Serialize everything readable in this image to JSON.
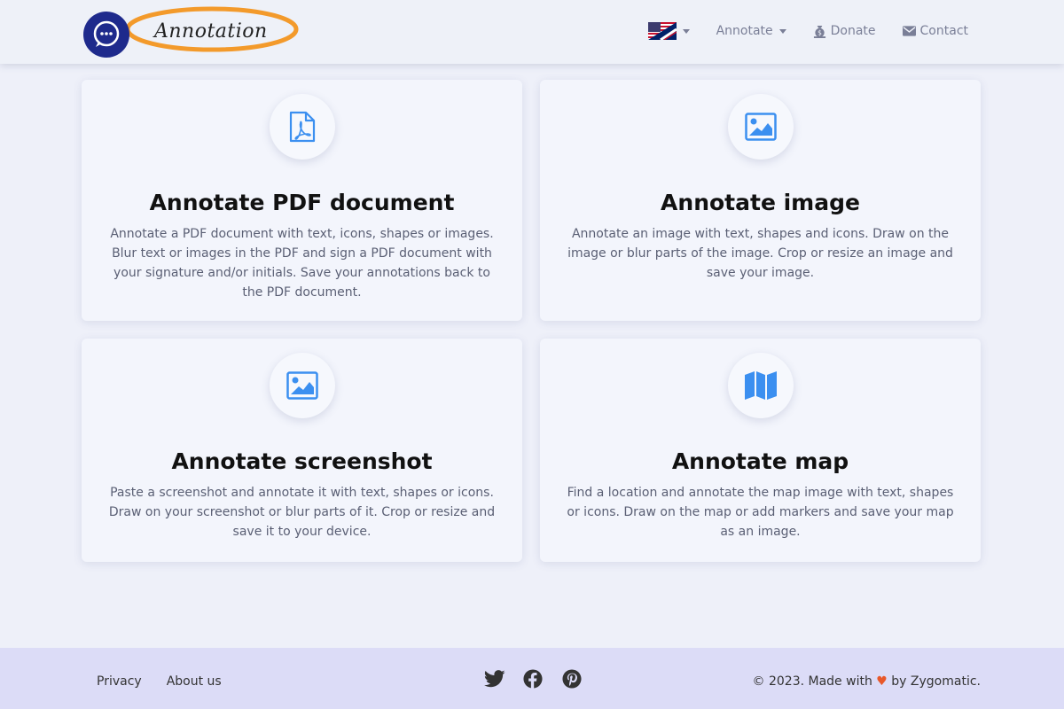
{
  "brand": {
    "name": "Annotation",
    "logo_icon": "chat-bubble-icon"
  },
  "nav": {
    "language_icon": "us-uk-flag-icon",
    "annotate_label": "Annotate",
    "donate_label": "Donate",
    "donate_icon": "money-bag-icon",
    "contact_label": "Contact",
    "contact_icon": "envelope-icon"
  },
  "cards": [
    {
      "icon": "pdf-icon",
      "title": "Annotate PDF document",
      "description": "Annotate a PDF document with text, icons, shapes or images. Blur text or images in the PDF and sign a PDF document with your signature and/or initials. Save your annotations back to the PDF document."
    },
    {
      "icon": "image-icon",
      "title": "Annotate image",
      "description": "Annotate an image with text, shapes and icons. Draw on the image or blur parts of the image. Crop or resize an image and save your image."
    },
    {
      "icon": "screenshot-image-icon",
      "title": "Annotate screenshot",
      "description": "Paste a screenshot and annotate it with text, shapes or icons. Draw on your screenshot or blur parts of it. Crop or resize and save it to your device."
    },
    {
      "icon": "map-icon",
      "title": "Annotate map",
      "description": "Find a location and annotate the map image with text, shapes or icons. Draw on the map or add markers and save your map as an image."
    }
  ],
  "footer": {
    "privacy_label": "Privacy",
    "about_label": "About us",
    "social_icons": [
      "twitter-icon",
      "facebook-icon",
      "pinterest-icon"
    ],
    "copyright_prefix": "© 2023. Made with",
    "heart": "♥",
    "copyright_suffix": "by Zygomatic."
  },
  "colors": {
    "accent": "#3b8ff0",
    "brand_ring": "#f39a2b",
    "brand_circle": "#1e2a8c",
    "heart": "#e8582a"
  }
}
